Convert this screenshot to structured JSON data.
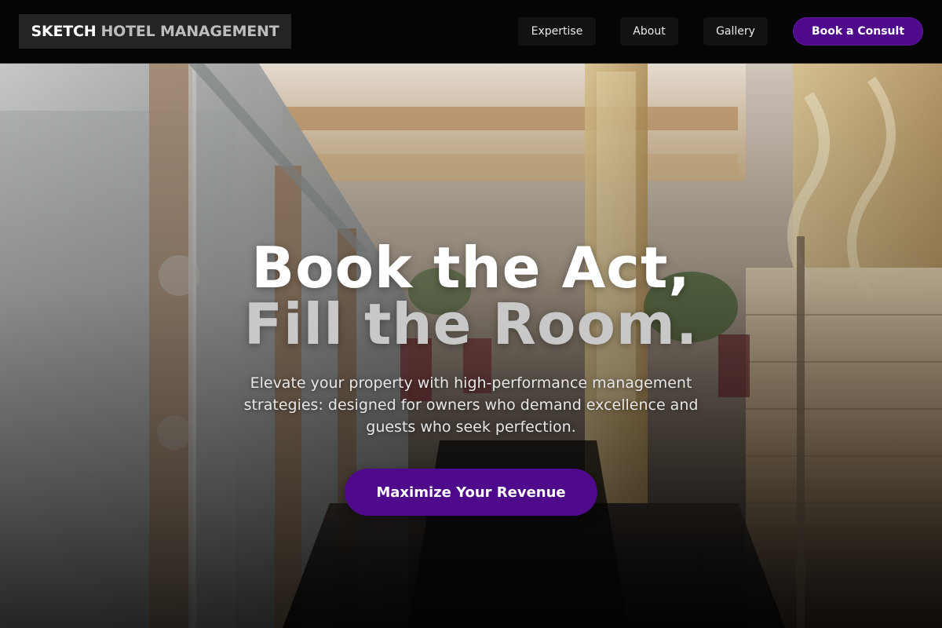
{
  "header": {
    "brand": "SKETCH",
    "brand_sub": "HOTEL MANAGEMENT",
    "nav": {
      "expertise": "Expertise",
      "about": "About",
      "gallery": "Gallery"
    },
    "cta": "Book a Consult"
  },
  "hero": {
    "headline_line1": "Book the Act,",
    "headline_line2": "Fill the Room.",
    "subcopy": "Elevate your property with high-performance management strategies: designed for owners who demand excellence and guests who seek perfection.",
    "cta": "Maximize Your Revenue",
    "background_image": "hotel-interior-photo"
  },
  "colors": {
    "accent": "#4f0a8c",
    "header_bg": "#050505",
    "logo_bg": "#242424",
    "nav_bg": "#121212"
  }
}
